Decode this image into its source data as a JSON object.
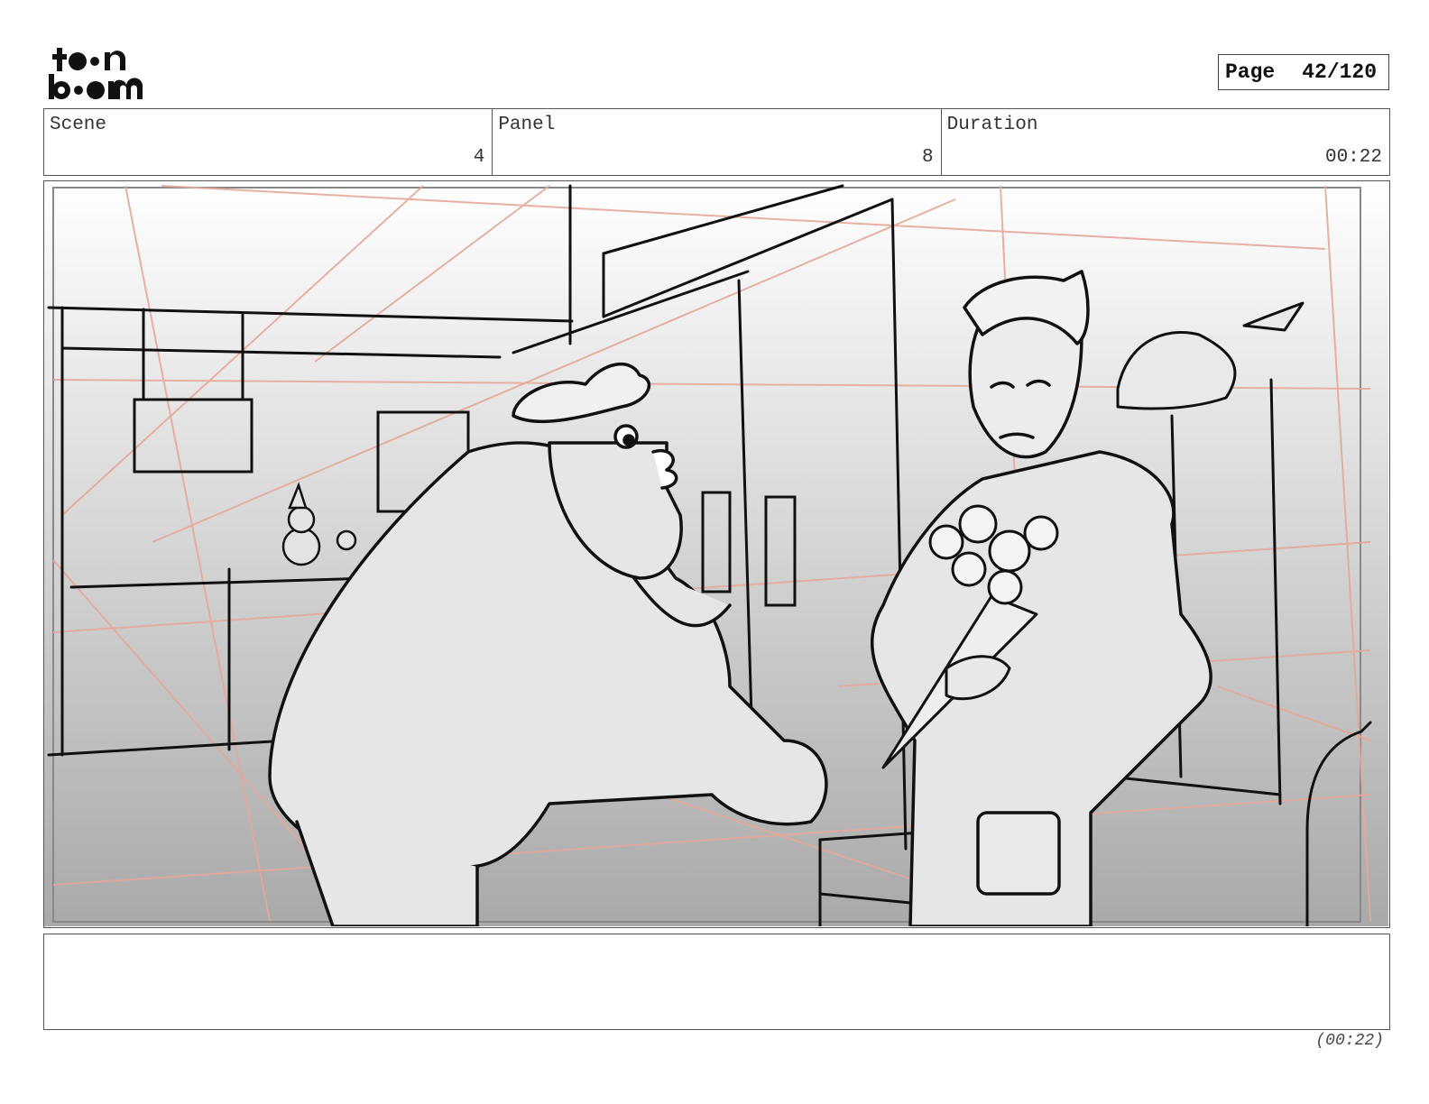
{
  "header": {
    "logo_text": "toon boom",
    "page_label": "Page",
    "page_number": "42/120"
  },
  "info": {
    "scene_label": "Scene",
    "scene_value": "4",
    "panel_label": "Panel",
    "panel_value": "8",
    "duration_label": "Duration",
    "duration_value": "00:22"
  },
  "panel": {
    "image_icon": "storyboard-sketch-image"
  },
  "notes": {
    "text": ""
  },
  "footer": {
    "total_duration": "(00:22)"
  }
}
